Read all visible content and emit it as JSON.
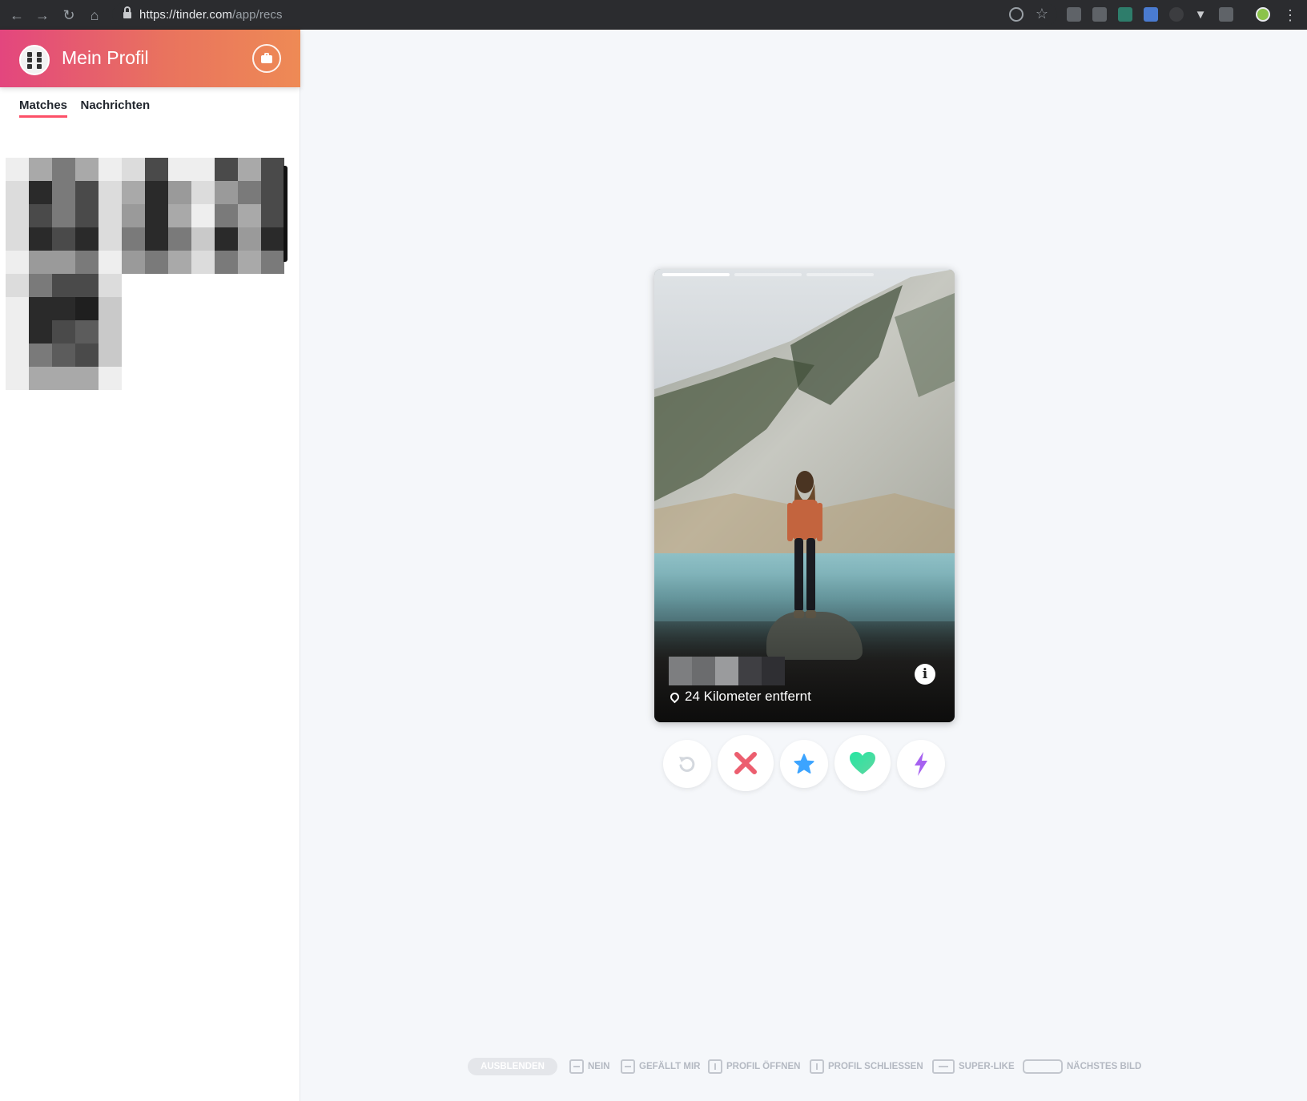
{
  "browser": {
    "url_host": "https://tinder.com",
    "url_path": "/app/recs"
  },
  "sidebar": {
    "profile_title": "Mein Profil",
    "tabs": [
      {
        "label": "Matches",
        "active": true
      },
      {
        "label": "Nachrichten",
        "active": false
      }
    ]
  },
  "card": {
    "photo_count": 3,
    "current_photo": 1,
    "distance": "24 Kilometer entfernt",
    "info_label": "i"
  },
  "actions": [
    {
      "name": "rewind",
      "icon": "rewind-icon",
      "color": "#d4d8de"
    },
    {
      "name": "nope",
      "icon": "x-icon",
      "color": "#ec5e6f"
    },
    {
      "name": "super-like",
      "icon": "star-icon",
      "color": "#3ca4ff"
    },
    {
      "name": "like",
      "icon": "heart-icon",
      "color": "#26e6a2"
    },
    {
      "name": "boost",
      "icon": "lightning-icon",
      "color": "#a661f0"
    }
  ],
  "shortcuts": {
    "hide": "AUSBLENDEN",
    "nope": "NEIN",
    "like": "GEFÄLLT MIR",
    "open_profile": "PROFIL ÖFFNEN",
    "close_profile": "PROFIL SCHLIESSEN",
    "super_like": "SUPER-LIKE",
    "next_photo": "NÄCHSTES BILD"
  },
  "colors": {
    "brand_gradient_start": "#e3467e",
    "brand_gradient_end": "#ee8a55",
    "tab_underline": "#fd5068"
  }
}
